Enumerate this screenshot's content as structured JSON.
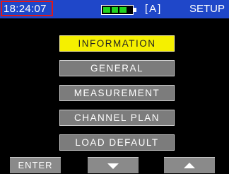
{
  "status_bar": {
    "time": "18:24:07",
    "battery_level": 0.75,
    "mode": "[A]",
    "page": "SETUP"
  },
  "menu": {
    "items": [
      {
        "label": "INFORMATION",
        "selected": true
      },
      {
        "label": "GENERAL",
        "selected": false
      },
      {
        "label": "MEASUREMENT",
        "selected": false
      },
      {
        "label": "CHANNEL PLAN",
        "selected": false
      },
      {
        "label": "LOAD DEFAULT",
        "selected": false
      }
    ]
  },
  "softkeys": {
    "enter": "ENTER",
    "down_icon": "down-arrow-icon",
    "up_icon": "up-arrow-icon"
  },
  "colors": {
    "status_bar": "#1f47c9",
    "selected_item": "#f5f000",
    "menu_item": "#7c7c7c",
    "battery_fill": "#21d321",
    "clock_border": "#e01818"
  }
}
